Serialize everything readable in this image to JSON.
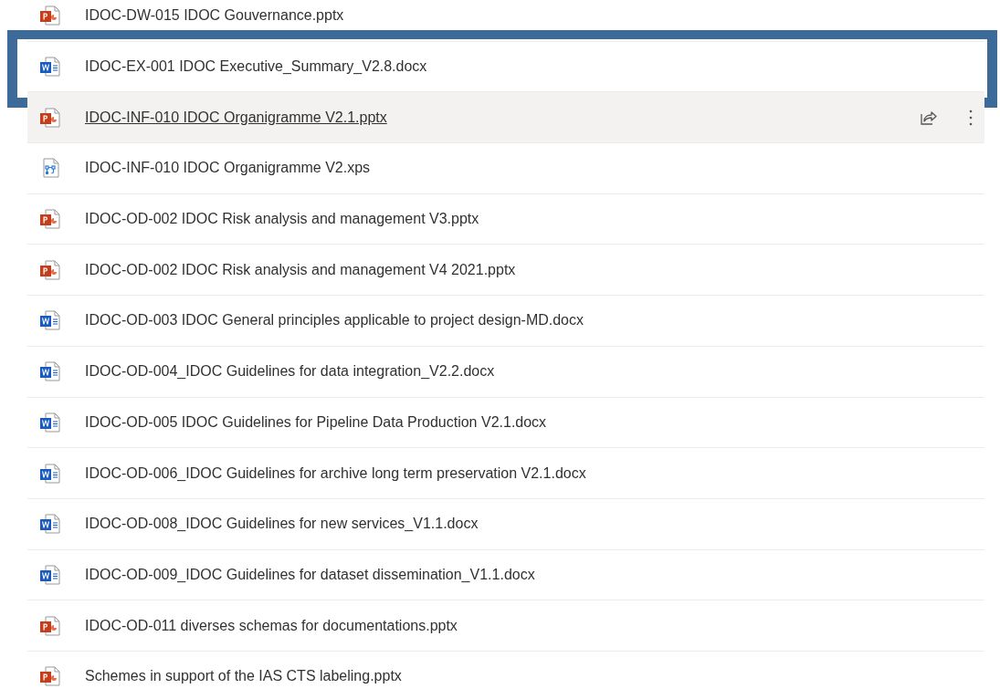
{
  "files": [
    {
      "name": "IDOC-DW-015 IDOC Gouvernance.pptx",
      "kind": "pptx",
      "highlighted": false,
      "hovered": false
    },
    {
      "name": "IDOC-EX-001 IDOC Executive_Summary_V2.8.docx",
      "kind": "docx",
      "highlighted": true,
      "hovered": false
    },
    {
      "name": "IDOC-INF-010 IDOC Organigramme V2.1.pptx",
      "kind": "pptx",
      "highlighted": false,
      "hovered": true
    },
    {
      "name": "IDOC-INF-010 IDOC Organigramme V2.xps",
      "kind": "xps",
      "highlighted": false,
      "hovered": false
    },
    {
      "name": "IDOC-OD-002 IDOC Risk analysis and management V3.pptx",
      "kind": "pptx",
      "highlighted": false,
      "hovered": false
    },
    {
      "name": "IDOC-OD-002 IDOC Risk analysis and management V4 2021.pptx",
      "kind": "pptx",
      "highlighted": false,
      "hovered": false
    },
    {
      "name": "IDOC-OD-003 IDOC General principles applicable to project design-MD.docx",
      "kind": "docx",
      "highlighted": false,
      "hovered": false
    },
    {
      "name": "IDOC-OD-004_IDOC Guidelines for data integration_V2.2.docx",
      "kind": "docx",
      "highlighted": false,
      "hovered": false
    },
    {
      "name": "IDOC-OD-005 IDOC Guidelines for Pipeline Data Production V2.1.docx",
      "kind": "docx",
      "highlighted": false,
      "hovered": false
    },
    {
      "name": "IDOC-OD-006_IDOC Guidelines for archive long term preservation V2.1.docx",
      "kind": "docx",
      "highlighted": false,
      "hovered": false
    },
    {
      "name": "IDOC-OD-008_IDOC Guidelines for new services_V1.1.docx",
      "kind": "docx",
      "highlighted": false,
      "hovered": false
    },
    {
      "name": "IDOC-OD-009_IDOC Guidelines for dataset dissemination_V1.1.docx",
      "kind": "docx",
      "highlighted": false,
      "hovered": false
    },
    {
      "name": "IDOC-OD-011 diverses schemas for documentations.pptx",
      "kind": "pptx",
      "highlighted": false,
      "hovered": false
    },
    {
      "name": "Schemes in support of the IAS CTS labeling.pptx",
      "kind": "pptx",
      "highlighted": false,
      "hovered": false
    }
  ]
}
